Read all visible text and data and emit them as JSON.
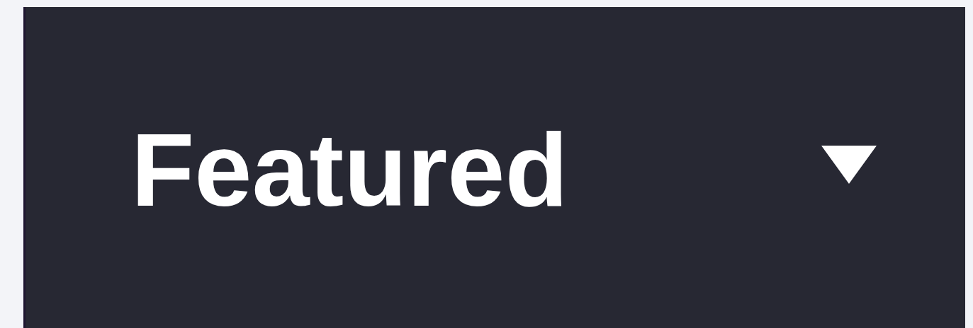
{
  "dropdown": {
    "label": "Featured"
  }
}
